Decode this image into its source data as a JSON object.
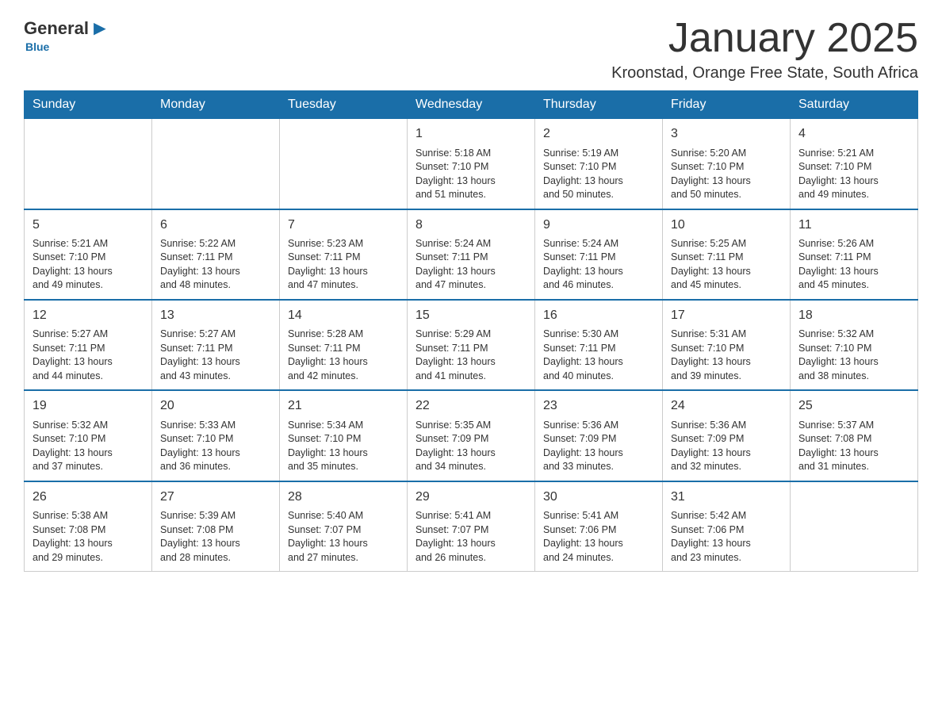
{
  "logo": {
    "general": "General",
    "blue": "Blue",
    "subtitle": "Blue"
  },
  "header": {
    "month": "January 2025",
    "location": "Kroonstad, Orange Free State, South Africa"
  },
  "weekdays": [
    "Sunday",
    "Monday",
    "Tuesday",
    "Wednesday",
    "Thursday",
    "Friday",
    "Saturday"
  ],
  "weeks": [
    [
      {
        "day": "",
        "info": ""
      },
      {
        "day": "",
        "info": ""
      },
      {
        "day": "",
        "info": ""
      },
      {
        "day": "1",
        "info": "Sunrise: 5:18 AM\nSunset: 7:10 PM\nDaylight: 13 hours\nand 51 minutes."
      },
      {
        "day": "2",
        "info": "Sunrise: 5:19 AM\nSunset: 7:10 PM\nDaylight: 13 hours\nand 50 minutes."
      },
      {
        "day": "3",
        "info": "Sunrise: 5:20 AM\nSunset: 7:10 PM\nDaylight: 13 hours\nand 50 minutes."
      },
      {
        "day": "4",
        "info": "Sunrise: 5:21 AM\nSunset: 7:10 PM\nDaylight: 13 hours\nand 49 minutes."
      }
    ],
    [
      {
        "day": "5",
        "info": "Sunrise: 5:21 AM\nSunset: 7:10 PM\nDaylight: 13 hours\nand 49 minutes."
      },
      {
        "day": "6",
        "info": "Sunrise: 5:22 AM\nSunset: 7:11 PM\nDaylight: 13 hours\nand 48 minutes."
      },
      {
        "day": "7",
        "info": "Sunrise: 5:23 AM\nSunset: 7:11 PM\nDaylight: 13 hours\nand 47 minutes."
      },
      {
        "day": "8",
        "info": "Sunrise: 5:24 AM\nSunset: 7:11 PM\nDaylight: 13 hours\nand 47 minutes."
      },
      {
        "day": "9",
        "info": "Sunrise: 5:24 AM\nSunset: 7:11 PM\nDaylight: 13 hours\nand 46 minutes."
      },
      {
        "day": "10",
        "info": "Sunrise: 5:25 AM\nSunset: 7:11 PM\nDaylight: 13 hours\nand 45 minutes."
      },
      {
        "day": "11",
        "info": "Sunrise: 5:26 AM\nSunset: 7:11 PM\nDaylight: 13 hours\nand 45 minutes."
      }
    ],
    [
      {
        "day": "12",
        "info": "Sunrise: 5:27 AM\nSunset: 7:11 PM\nDaylight: 13 hours\nand 44 minutes."
      },
      {
        "day": "13",
        "info": "Sunrise: 5:27 AM\nSunset: 7:11 PM\nDaylight: 13 hours\nand 43 minutes."
      },
      {
        "day": "14",
        "info": "Sunrise: 5:28 AM\nSunset: 7:11 PM\nDaylight: 13 hours\nand 42 minutes."
      },
      {
        "day": "15",
        "info": "Sunrise: 5:29 AM\nSunset: 7:11 PM\nDaylight: 13 hours\nand 41 minutes."
      },
      {
        "day": "16",
        "info": "Sunrise: 5:30 AM\nSunset: 7:11 PM\nDaylight: 13 hours\nand 40 minutes."
      },
      {
        "day": "17",
        "info": "Sunrise: 5:31 AM\nSunset: 7:10 PM\nDaylight: 13 hours\nand 39 minutes."
      },
      {
        "day": "18",
        "info": "Sunrise: 5:32 AM\nSunset: 7:10 PM\nDaylight: 13 hours\nand 38 minutes."
      }
    ],
    [
      {
        "day": "19",
        "info": "Sunrise: 5:32 AM\nSunset: 7:10 PM\nDaylight: 13 hours\nand 37 minutes."
      },
      {
        "day": "20",
        "info": "Sunrise: 5:33 AM\nSunset: 7:10 PM\nDaylight: 13 hours\nand 36 minutes."
      },
      {
        "day": "21",
        "info": "Sunrise: 5:34 AM\nSunset: 7:10 PM\nDaylight: 13 hours\nand 35 minutes."
      },
      {
        "day": "22",
        "info": "Sunrise: 5:35 AM\nSunset: 7:09 PM\nDaylight: 13 hours\nand 34 minutes."
      },
      {
        "day": "23",
        "info": "Sunrise: 5:36 AM\nSunset: 7:09 PM\nDaylight: 13 hours\nand 33 minutes."
      },
      {
        "day": "24",
        "info": "Sunrise: 5:36 AM\nSunset: 7:09 PM\nDaylight: 13 hours\nand 32 minutes."
      },
      {
        "day": "25",
        "info": "Sunrise: 5:37 AM\nSunset: 7:08 PM\nDaylight: 13 hours\nand 31 minutes."
      }
    ],
    [
      {
        "day": "26",
        "info": "Sunrise: 5:38 AM\nSunset: 7:08 PM\nDaylight: 13 hours\nand 29 minutes."
      },
      {
        "day": "27",
        "info": "Sunrise: 5:39 AM\nSunset: 7:08 PM\nDaylight: 13 hours\nand 28 minutes."
      },
      {
        "day": "28",
        "info": "Sunrise: 5:40 AM\nSunset: 7:07 PM\nDaylight: 13 hours\nand 27 minutes."
      },
      {
        "day": "29",
        "info": "Sunrise: 5:41 AM\nSunset: 7:07 PM\nDaylight: 13 hours\nand 26 minutes."
      },
      {
        "day": "30",
        "info": "Sunrise: 5:41 AM\nSunset: 7:06 PM\nDaylight: 13 hours\nand 24 minutes."
      },
      {
        "day": "31",
        "info": "Sunrise: 5:42 AM\nSunset: 7:06 PM\nDaylight: 13 hours\nand 23 minutes."
      },
      {
        "day": "",
        "info": ""
      }
    ]
  ]
}
